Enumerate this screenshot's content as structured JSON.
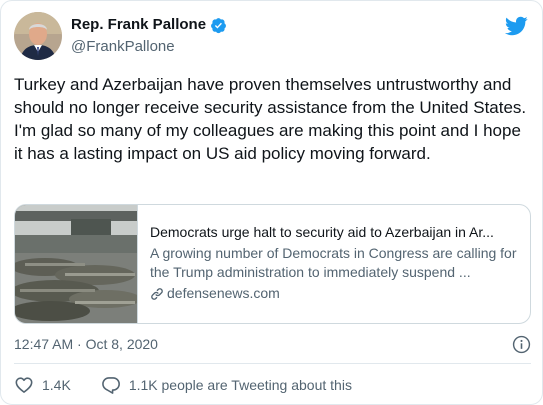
{
  "author": {
    "name": "Rep. Frank Pallone",
    "handle": "@FrankPallone"
  },
  "tweet": {
    "text": "Turkey and Azerbaijan have proven themselves untrustworthy and should no longer receive security assistance from the United States. I'm glad so many of my colleagues are making this point and I hope it has a lasting impact on US aid policy moving forward.",
    "timestamp": "12:47 AM · Oct 8, 2020"
  },
  "card": {
    "title": "Democrats urge halt to security aid to Azerbaijan in Ar...",
    "description": "A growing number of Democrats in Congress are calling for the Trump administration to immediately suspend ...",
    "domain": "defensenews.com"
  },
  "actions": {
    "likes": "1.4K",
    "conversation": "1.1K people are Tweeting about this"
  },
  "colors": {
    "twitter_blue": "#1d9bf0",
    "secondary_text": "#536471",
    "primary_text": "#0f1419",
    "border": "#cfd9de"
  },
  "icons": [
    "verified-badge-icon",
    "twitter-bird-icon",
    "link-icon",
    "info-icon",
    "heart-icon",
    "reply-icon"
  ]
}
